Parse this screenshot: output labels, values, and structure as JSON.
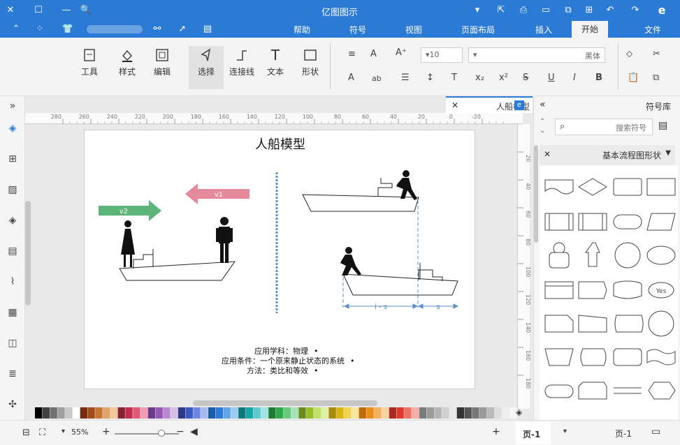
{
  "app": {
    "title": "亿图图示"
  },
  "menu": {
    "file": "文件",
    "start": "开始",
    "insert": "插入",
    "page_layout": "页面布局",
    "view": "视图",
    "symbols": "符号",
    "help": "帮助"
  },
  "ribbon": {
    "tools": "工具",
    "style": "样式",
    "edit": "编辑",
    "select": "选择",
    "connector": "连接线",
    "text": "文本",
    "shape": "形状",
    "font_name": "黑体",
    "font_size": "10"
  },
  "tabs": {
    "doc_tab": "人船模型"
  },
  "ruler_h": [
    "280",
    "260",
    "240",
    "220",
    "200",
    "180",
    "160",
    "140",
    "120",
    "100",
    "80",
    "60",
    "40",
    "20",
    "0",
    "-20"
  ],
  "ruler_v": [
    "20",
    "40",
    "60",
    "80",
    "100",
    "120",
    "140",
    "160",
    "180"
  ],
  "diagram": {
    "title": "人船模型",
    "arrow_v2": "v2",
    "arrow_v1": "v1",
    "label_l_s": "l - s",
    "label_s": "s",
    "bullets": [
      "应用学科：物理",
      "应用条件：一个原来静止状态的系统",
      "方法：类比和等效"
    ]
  },
  "right_panel": {
    "title": "符号库",
    "search_placeholder": "搜索符号",
    "library_name": "基本流程图形状",
    "shape_yes": "Yes"
  },
  "status": {
    "page_tab": "页-1",
    "page_label": "页-1",
    "zoom": "55%"
  },
  "colors": {
    "brand": "#2b7bd6",
    "arrow_green": "#5db57a",
    "arrow_pink": "#e48a9a",
    "dash_blue": "#5b8fc7"
  },
  "palette_colors": [
    "#000000",
    "#404040",
    "#707070",
    "#a0a0a0",
    "#c8c8c8",
    "#ffffff",
    "#7b2b0e",
    "#a04b1a",
    "#c87332",
    "#e0a36b",
    "#f0c89c",
    "#8a1f35",
    "#c02b4b",
    "#e35a78",
    "#f19bb0",
    "#6b3a8a",
    "#9457b6",
    "#b98ad3",
    "#d8bde8",
    "#2b3a8a",
    "#3f59bf",
    "#6d86e0",
    "#a9b9f0",
    "#1b5ea8",
    "#2b7bd6",
    "#5fa3e6",
    "#9cc9f2",
    "#0d7a7a",
    "#18a5a5",
    "#5ccaca",
    "#a1e3e3",
    "#1f7a36",
    "#2ea84b",
    "#66c97c",
    "#a6e3b2",
    "#6b8a1f",
    "#98bf2b",
    "#c3df66",
    "#e0f0a6",
    "#a88a0a",
    "#d9b516",
    "#f2d34f",
    "#f8e79a",
    "#c46a0a",
    "#e88c1a",
    "#f4b05a",
    "#f9d3a0",
    "#b02b1f",
    "#dc3b2e",
    "#ef7367",
    "#f7aea7",
    "#7a7a7a",
    "#9a9a9a",
    "#b5b5b5",
    "#d0d0d0",
    "#e8e8e8",
    "#333333",
    "#555555",
    "#777777",
    "#999999",
    "#bbbbbb",
    "#dddddd",
    "#eeeeee",
    "#f7f7f7"
  ]
}
